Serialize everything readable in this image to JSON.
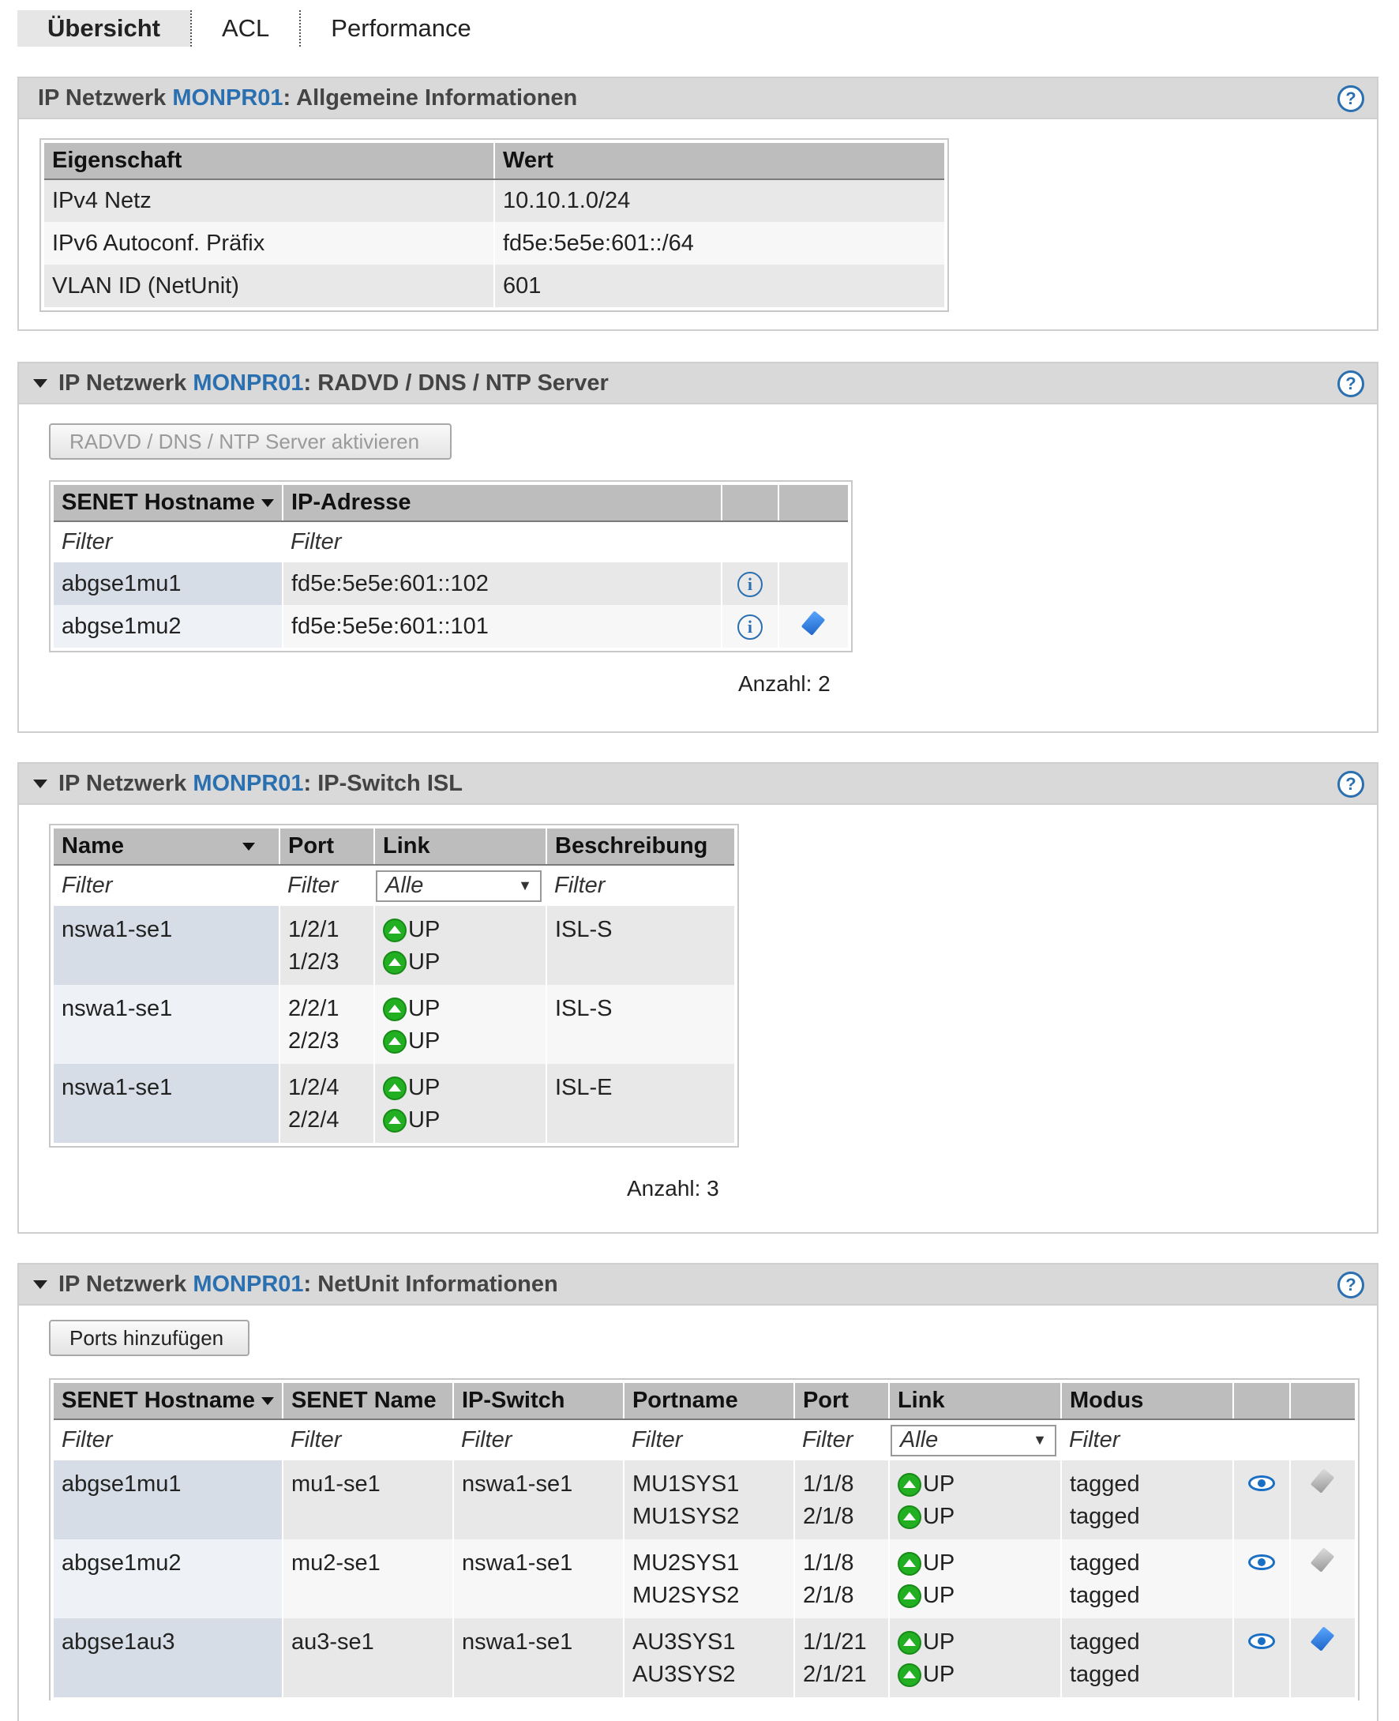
{
  "tabs": [
    {
      "label": "Übersicht",
      "active": true
    },
    {
      "label": "ACL",
      "active": false
    },
    {
      "label": "Performance",
      "active": false
    }
  ],
  "panel1": {
    "title_prefix": "IP Netzwerk",
    "network": "MONPR01",
    "title_suffix": ": Allgemeine Informationen",
    "headers": [
      "Eigenschaft",
      "Wert"
    ],
    "rows": [
      {
        "prop": "IPv4 Netz",
        "value": "10.10.1.0/24"
      },
      {
        "prop": "IPv6 Autoconf. Präfix",
        "value": "fd5e:5e5e:601::/64"
      },
      {
        "prop": "VLAN ID (NetUnit)",
        "value": "601"
      }
    ]
  },
  "panel2": {
    "title_prefix": "IP Netzwerk",
    "network": "MONPR01",
    "title_suffix": ": RADVD / DNS / NTP Server",
    "button": "RADVD / DNS / NTP Server aktivieren",
    "headers": [
      "SENET Hostname",
      "IP-Adresse"
    ],
    "filter": "Filter",
    "rows": [
      {
        "host": "abgse1mu1",
        "ip": "fd5e:5e5e:601::102"
      },
      {
        "host": "abgse1mu2",
        "ip": "fd5e:5e5e:601::101"
      }
    ],
    "count": "Anzahl: 2"
  },
  "panel3": {
    "title_prefix": "IP Netzwerk",
    "network": "MONPR01",
    "title_suffix": ": IP-Switch ISL",
    "headers": [
      "Name",
      "Port",
      "Link",
      "Beschreibung"
    ],
    "filter": "Filter",
    "select_value": "Alle",
    "rows": [
      {
        "name": "nswa1-se1",
        "port1": "1/2/1",
        "port2": "1/2/3",
        "link1": "UP",
        "link2": "UP",
        "desc": "ISL-S"
      },
      {
        "name": "nswa1-se1",
        "port1": "2/2/1",
        "port2": "2/2/3",
        "link1": "UP",
        "link2": "UP",
        "desc": "ISL-S"
      },
      {
        "name": "nswa1-se1",
        "port1": "1/2/4",
        "port2": "2/2/4",
        "link1": "UP",
        "link2": "UP",
        "desc": "ISL-E"
      }
    ],
    "count": "Anzahl: 3"
  },
  "panel4": {
    "title_prefix": "IP Netzwerk",
    "network": "MONPR01",
    "title_suffix": ": NetUnit Informationen",
    "button": "Ports hinzufügen",
    "headers": [
      "SENET Hostname",
      "SENET Name",
      "IP-Switch",
      "Portname",
      "Port",
      "Link",
      "Modus"
    ],
    "filter": "Filter",
    "select_value": "Alle",
    "rows": [
      {
        "host": "abgse1mu1",
        "name": "mu1-se1",
        "switch": "nswa1-se1",
        "pn1": "MU1SYS1",
        "pn2": "MU1SYS2",
        "p1": "1/1/8",
        "p2": "2/1/8",
        "l1": "UP",
        "l2": "UP",
        "m1": "tagged",
        "m2": "tagged"
      },
      {
        "host": "abgse1mu2",
        "name": "mu2-se1",
        "switch": "nswa1-se1",
        "pn1": "MU2SYS1",
        "pn2": "MU2SYS2",
        "p1": "1/1/8",
        "p2": "2/1/8",
        "l1": "UP",
        "l2": "UP",
        "m1": "tagged",
        "m2": "tagged"
      },
      {
        "host": "abgse1au3",
        "name": "au3-se1",
        "switch": "nswa1-se1",
        "pn1": "AU3SYS1",
        "pn2": "AU3SYS2",
        "p1": "1/1/21",
        "p2": "2/1/21",
        "l1": "UP",
        "l2": "UP",
        "m1": "tagged",
        "m2": "tagged"
      }
    ]
  },
  "help_symbol": "?",
  "info_symbol": "i"
}
